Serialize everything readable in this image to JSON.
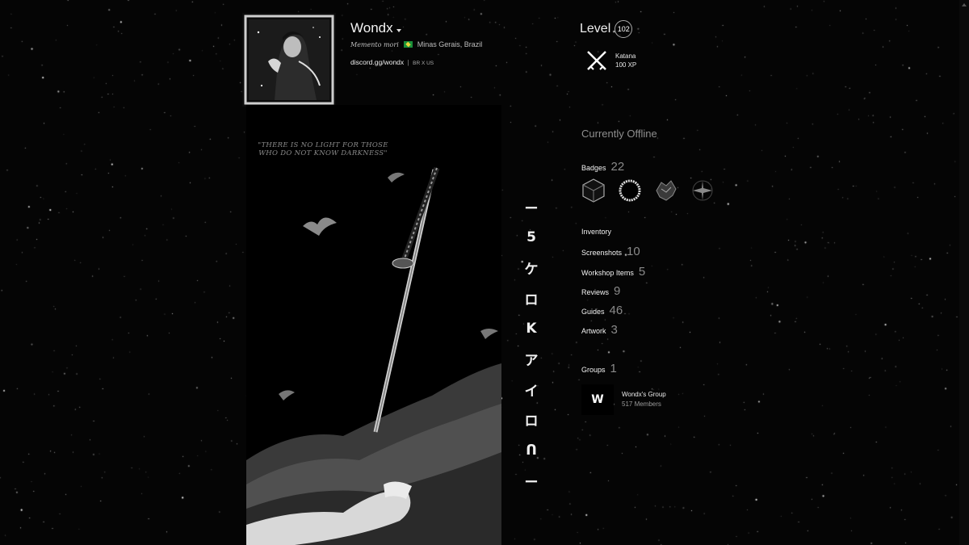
{
  "profile": {
    "name": "Wondx",
    "motto": "Memento mori",
    "location": "Minas Gerais, Brazil",
    "link": "discord.gg/wondx",
    "link_extra": "BR X US"
  },
  "level": {
    "label": "Level",
    "value": "102"
  },
  "featured_badge": {
    "name": "Katana",
    "xp": "100 XP",
    "icon": "crossed-swords-icon"
  },
  "showcase": {
    "quote_line1": "\"THERE IS NO LIGHT FOR THOSE",
    "quote_line2": "WHO DO NOT KNOW DARKNESS\"",
    "glyphs": [
      "ー",
      "5",
      "ケ",
      "ロ",
      " K",
      "ア",
      "イ",
      "ロ",
      "ᑎ",
      "ー"
    ]
  },
  "status": "Currently Offline",
  "badges": {
    "label": "Badges",
    "count": "22",
    "icons": [
      "cube-badge-icon",
      "ring-badge-icon",
      "leaf-badge-icon",
      "burst-badge-icon"
    ]
  },
  "sections": [
    {
      "label": "Inventory",
      "count": ""
    },
    {
      "label": "Screenshots",
      "count": "10"
    },
    {
      "label": "Workshop Items",
      "count": "5"
    },
    {
      "label": "Reviews",
      "count": "9"
    },
    {
      "label": "Guides",
      "count": "46"
    },
    {
      "label": "Artwork",
      "count": "3"
    }
  ],
  "groups": {
    "label": "Groups",
    "count": "1",
    "item": {
      "avatar": "W",
      "name": "Wondx's Group",
      "members": "517 Members"
    }
  },
  "colors": {
    "background": "#050505",
    "text": "#f2f2f2",
    "muted": "#8a8a8a"
  }
}
